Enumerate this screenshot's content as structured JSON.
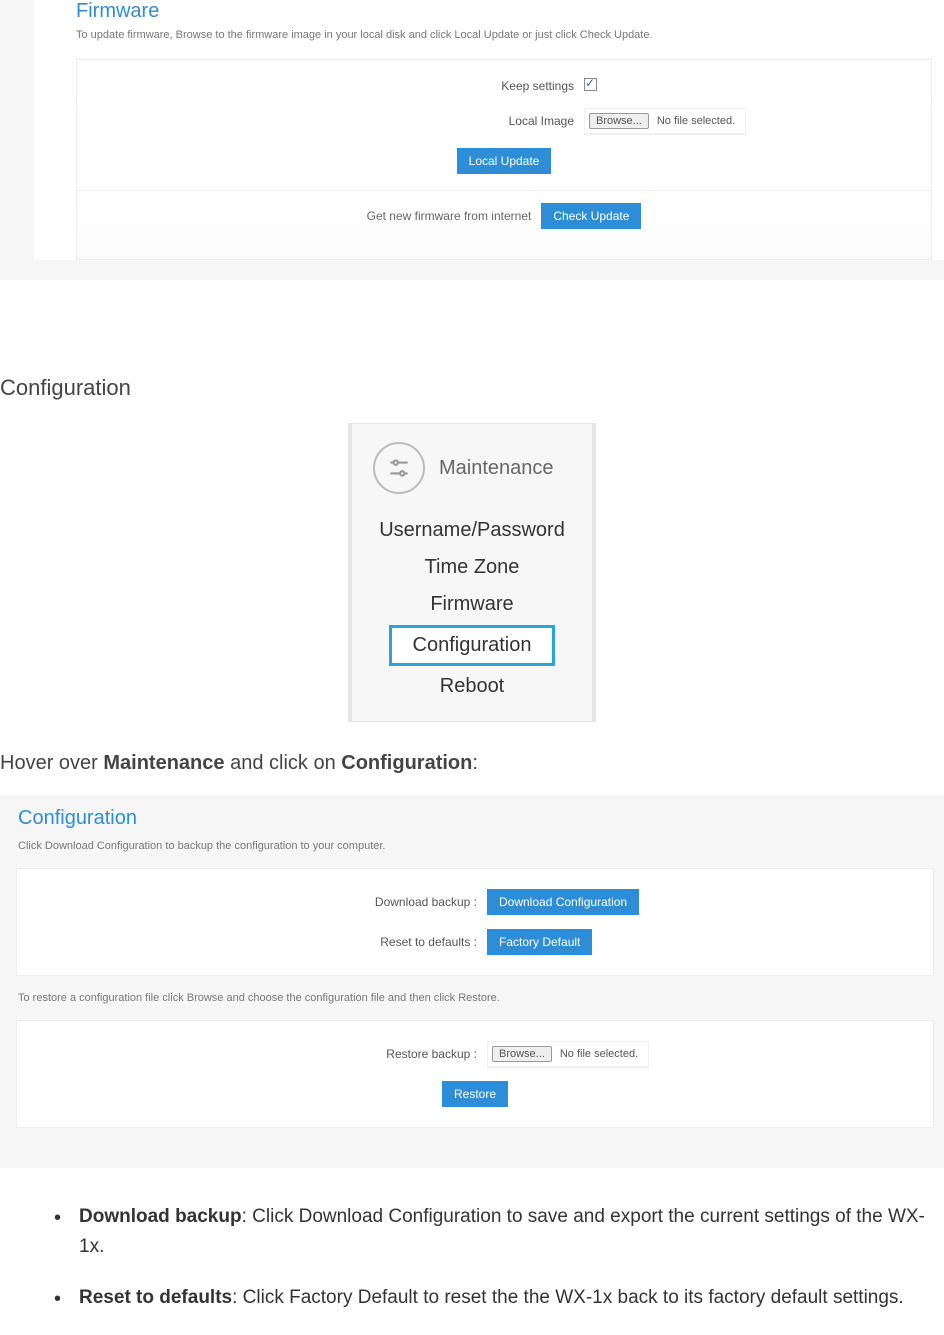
{
  "firmware": {
    "title": "Firmware",
    "desc": "To update firmware, Browse to the firmware image in your local disk and click Local Update or just click Check Update.",
    "keep_settings_label": "Keep settings",
    "local_image_label": "Local Image",
    "browse_label": "Browse...",
    "no_file_label": "No file selected.",
    "local_update_btn": "Local Update",
    "get_new_label": "Get new firmware from internet",
    "check_update_btn": "Check Update"
  },
  "section_heading": "Configuration",
  "menu": {
    "header": "Maintenance",
    "items": [
      "Username/Password",
      "Time Zone",
      "Firmware",
      "Configuration",
      "Reboot"
    ]
  },
  "hover_text": {
    "prefix": "Hover over ",
    "b1": "Maintenance",
    "mid": " and click on ",
    "b2": "Configuration",
    "suffix": ":"
  },
  "config": {
    "title": "Configuration",
    "desc1": "Click Download Configuration to backup the configuration to your computer.",
    "download_label": "Download backup :",
    "download_btn": "Download Configuration",
    "reset_label": "Reset to defaults :",
    "reset_btn": "Factory Default",
    "desc2": "To restore a configuration file click Browse and choose the configuration file and then click Restore.",
    "restore_label": "Restore backup :",
    "browse_label": "Browse...",
    "no_file_label": "No file selected.",
    "restore_btn": "Restore"
  },
  "bullets": {
    "b1_bold": "Download backup",
    "b1_text": ": Click Download Configuration to save and export the current settings of the WX-1x.",
    "b2_bold": "Reset to defaults",
    "b2_text": ": Click Factory Default to reset the the WX-1x back to its factory default settings."
  }
}
